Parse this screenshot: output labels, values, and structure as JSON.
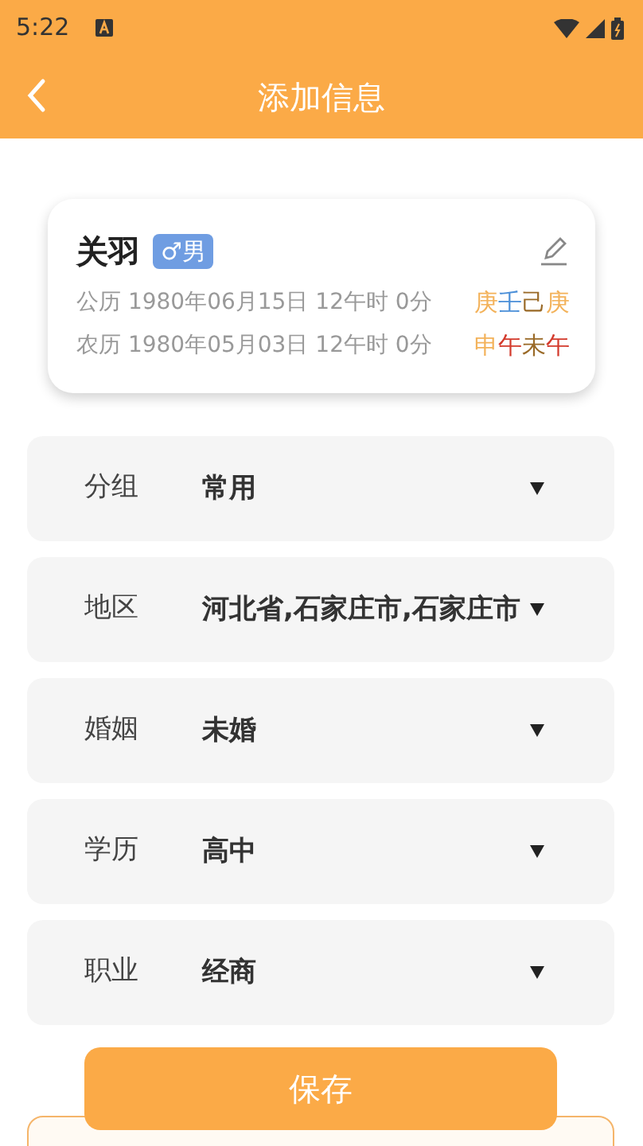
{
  "status_bar": {
    "time": "5:22"
  },
  "header": {
    "title": "添加信息"
  },
  "profile": {
    "name": "关羽",
    "gender": "♂男",
    "dates": [
      {
        "text": "公历 1980年06月15日 12午时 0分",
        "pillars": [
          {
            "char": "庚",
            "color": "#f3b25a"
          },
          {
            "char": "壬",
            "color": "#4b8fd8"
          },
          {
            "char": "己",
            "color": "#9a6a28"
          },
          {
            "char": "庚",
            "color": "#f3b25a"
          }
        ]
      },
      {
        "text": "农历 1980年05月03日 12午时 0分",
        "pillars": [
          {
            "char": "申",
            "color": "#f3b25a"
          },
          {
            "char": "午",
            "color": "#d33a2c"
          },
          {
            "char": "未",
            "color": "#9a6a28"
          },
          {
            "char": "午",
            "color": "#d33a2c"
          }
        ]
      }
    ]
  },
  "fields": [
    {
      "label": "分组",
      "value": "常用"
    },
    {
      "label": "地区",
      "value": "河北省,石家庄市,石家庄市"
    },
    {
      "label": "婚姻",
      "value": "未婚"
    },
    {
      "label": "学历",
      "value": "高中"
    },
    {
      "label": "职业",
      "value": "经商"
    }
  ],
  "save_button": "保存"
}
